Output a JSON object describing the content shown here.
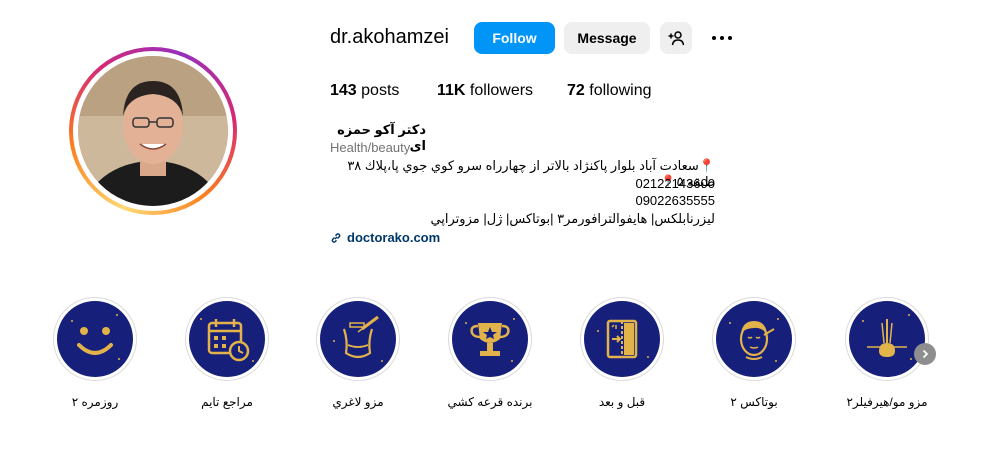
{
  "profile": {
    "username": "dr.akohamzei",
    "follow_label": "Follow",
    "message_label": "Message",
    "full_name": "دکتر آکو حمزه ای",
    "category": "Health/beauty",
    "bio": [
      "📍سعادت آباد بلوار پاكنژاد بالاتر از چهارراه سرو كوي جوي پا،پلاك ۳۸ طبقه ۵📍",
      "02122143600",
      "09022635555",
      "ليزرنابلكس| هايفوالترافورمر٣ |بوتاكس| ژل| مزوتراپي"
    ],
    "link": "doctorako.com"
  },
  "stats": {
    "posts_count": "143",
    "posts_label": "posts",
    "followers_count": "11K",
    "followers_label": "followers",
    "following_count": "72",
    "following_label": "following"
  },
  "highlights": [
    {
      "label": "روزمره ۲",
      "icon": "smiley-icon"
    },
    {
      "label": "مراجع تايم",
      "icon": "calendar-clock-icon"
    },
    {
      "label": "مزو لاغري",
      "icon": "body-syringe-icon"
    },
    {
      "label": "برنده قرعه كشي",
      "icon": "trophy-icon"
    },
    {
      "label": "قبل و بعد",
      "icon": "before-after-icon"
    },
    {
      "label": "بوتاكس ٢",
      "icon": "face-icon"
    },
    {
      "label": "مزو مو/هيرفيلر٢",
      "icon": "hair-follicle-icon"
    }
  ],
  "colors": {
    "accent": "#0095f6",
    "highlight_bg": "#16207a",
    "highlight_icon": "#e2b34a",
    "link": "#00376b"
  }
}
